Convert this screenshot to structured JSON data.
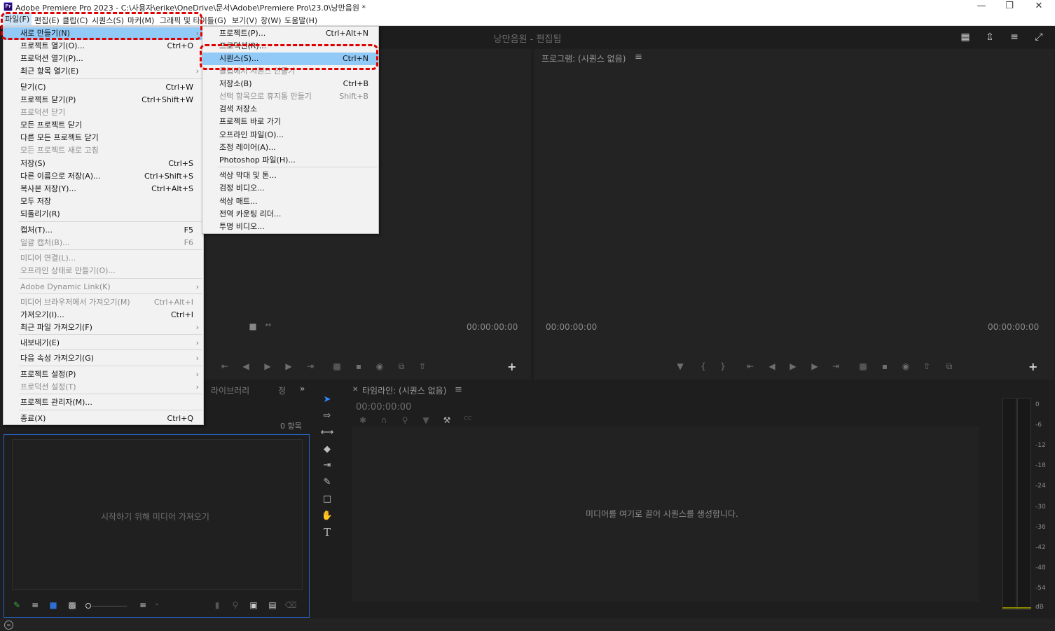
{
  "window": {
    "title": "Adobe Premiere Pro 2023 - C:\\사용자\\erike\\OneDrive\\문서\\Adobe\\Premiere Pro\\23.0\\낭만음원 *",
    "app_icon": "Pr",
    "controls": [
      "minimize-icon",
      "restore-icon",
      "close-icon"
    ]
  },
  "menubar": {
    "items": [
      "파일(F)",
      "편집(E)",
      "클립(C)",
      "시퀀스(S)",
      "마커(M)",
      "그래픽 및 타이틀(G)",
      "보기(V)",
      "창(W)",
      "도움말(H)"
    ]
  },
  "header": {
    "workspace_title": "낭만음원 - 편집됨"
  },
  "source": {
    "timecode_right": "00:00:00:00"
  },
  "program": {
    "title": "프로그램: (시퀀스 없음)",
    "timecode_left": "00:00:00:00",
    "timecode_right": "00:00:00:00"
  },
  "project": {
    "tab_library": "라이브러리",
    "tab_info": "정",
    "item_count": "0 항목",
    "empty_text": "시작하기 위해 미디어 가져오기"
  },
  "timeline": {
    "title": "타임라인: (시퀀스 없음)",
    "timecode": "00:00:00:00",
    "empty_text": "미디어를 여기로 끌어 시퀀스를 생성합니다."
  },
  "meter": {
    "labels": [
      "0",
      "-6",
      "-12",
      "-18",
      "-24",
      "-30",
      "-36",
      "-42",
      "-48",
      "-54",
      "dB"
    ]
  },
  "file_menu": {
    "items": [
      {
        "label": "새로 만들기(N)",
        "shortcut": "",
        "submenu": true,
        "disabled": false,
        "highlight": true
      },
      {
        "label": "프로젝트 열기(O)...",
        "shortcut": "Ctrl+O",
        "submenu": false,
        "disabled": false
      },
      {
        "label": "프로덕션 열기(P)...",
        "shortcut": "",
        "submenu": false,
        "disabled": false
      },
      {
        "label": "최근 항목 열기(E)",
        "shortcut": "",
        "submenu": true,
        "disabled": false
      },
      {
        "label": "닫기(C)",
        "shortcut": "Ctrl+W",
        "submenu": false,
        "disabled": false
      },
      {
        "label": "프로젝트 닫기(P)",
        "shortcut": "Ctrl+Shift+W",
        "submenu": false,
        "disabled": false
      },
      {
        "label": "프로덕션 닫기",
        "shortcut": "",
        "submenu": false,
        "disabled": true
      },
      {
        "label": "모든 프로젝트 닫기",
        "shortcut": "",
        "submenu": false,
        "disabled": false
      },
      {
        "label": "다른 모든 프로젝트 닫기",
        "shortcut": "",
        "submenu": false,
        "disabled": false
      },
      {
        "label": "모든 프로젝트 새로 고침",
        "shortcut": "",
        "submenu": false,
        "disabled": true
      },
      {
        "label": "저장(S)",
        "shortcut": "Ctrl+S",
        "submenu": false,
        "disabled": false
      },
      {
        "label": "다른 이름으로 저장(A)...",
        "shortcut": "Ctrl+Shift+S",
        "submenu": false,
        "disabled": false
      },
      {
        "label": "복사본 저장(Y)...",
        "shortcut": "Ctrl+Alt+S",
        "submenu": false,
        "disabled": false
      },
      {
        "label": "모두 저장",
        "shortcut": "",
        "submenu": false,
        "disabled": false
      },
      {
        "label": "되돌리기(R)",
        "shortcut": "",
        "submenu": false,
        "disabled": false
      },
      {
        "label": "캡처(T)...",
        "shortcut": "F5",
        "submenu": false,
        "disabled": false
      },
      {
        "label": "일괄 캡처(B)...",
        "shortcut": "F6",
        "submenu": false,
        "disabled": true
      },
      {
        "label": "미디어 연결(L)...",
        "shortcut": "",
        "submenu": false,
        "disabled": true
      },
      {
        "label": "오프라인 상태로 만들기(O)...",
        "shortcut": "",
        "submenu": false,
        "disabled": true
      },
      {
        "label": "Adobe Dynamic Link(K)",
        "shortcut": "",
        "submenu": true,
        "disabled": true
      },
      {
        "label": "미디어 브라우저에서 가져오기(M)",
        "shortcut": "Ctrl+Alt+I",
        "submenu": false,
        "disabled": true
      },
      {
        "label": "가져오기(I)...",
        "shortcut": "Ctrl+I",
        "submenu": false,
        "disabled": false
      },
      {
        "label": "최근 파일 가져오기(F)",
        "shortcut": "",
        "submenu": true,
        "disabled": false
      },
      {
        "label": "내보내기(E)",
        "shortcut": "",
        "submenu": true,
        "disabled": false
      },
      {
        "label": "다음 속성 가져오기(G)",
        "shortcut": "",
        "submenu": true,
        "disabled": false
      },
      {
        "label": "프로젝트 설정(P)",
        "shortcut": "",
        "submenu": true,
        "disabled": false
      },
      {
        "label": "프로덕션 설정(T)",
        "shortcut": "",
        "submenu": true,
        "disabled": true
      },
      {
        "label": "프로젝트 관리자(M)...",
        "shortcut": "",
        "submenu": false,
        "disabled": false
      },
      {
        "label": "종료(X)",
        "shortcut": "Ctrl+Q",
        "submenu": false,
        "disabled": false
      }
    ]
  },
  "new_submenu": {
    "items": [
      {
        "label": "프로젝트(P)...",
        "shortcut": "Ctrl+Alt+N",
        "disabled": false
      },
      {
        "label": "프로덕션(R)...",
        "shortcut": "",
        "disabled": false
      },
      {
        "label": "시퀀스(S)...",
        "shortcut": "Ctrl+N",
        "disabled": false,
        "highlight": true
      },
      {
        "label": "클립에서 시퀀스 만들기",
        "shortcut": "",
        "disabled": true
      },
      {
        "label": "저장소(B)",
        "shortcut": "Ctrl+B",
        "disabled": false
      },
      {
        "label": "선택 항목으로 휴지통 만들기",
        "shortcut": "Shift+B",
        "disabled": true
      },
      {
        "label": "검색 저장소",
        "shortcut": "",
        "disabled": false
      },
      {
        "label": "프로젝트 바로 가기",
        "shortcut": "",
        "disabled": false
      },
      {
        "label": "오프라인 파일(O)...",
        "shortcut": "",
        "disabled": false
      },
      {
        "label": "조정 레이어(A)...",
        "shortcut": "",
        "disabled": false
      },
      {
        "label": "Photoshop 파일(H)...",
        "shortcut": "",
        "disabled": false
      },
      {
        "label": "색상 막대 및 톤...",
        "shortcut": "",
        "disabled": false
      },
      {
        "label": "검정 비디오...",
        "shortcut": "",
        "disabled": false
      },
      {
        "label": "색상 매트...",
        "shortcut": "",
        "disabled": false
      },
      {
        "label": "전역 카운팅 리더...",
        "shortcut": "",
        "disabled": false
      },
      {
        "label": "투명 비디오...",
        "shortcut": "",
        "disabled": false
      }
    ]
  }
}
